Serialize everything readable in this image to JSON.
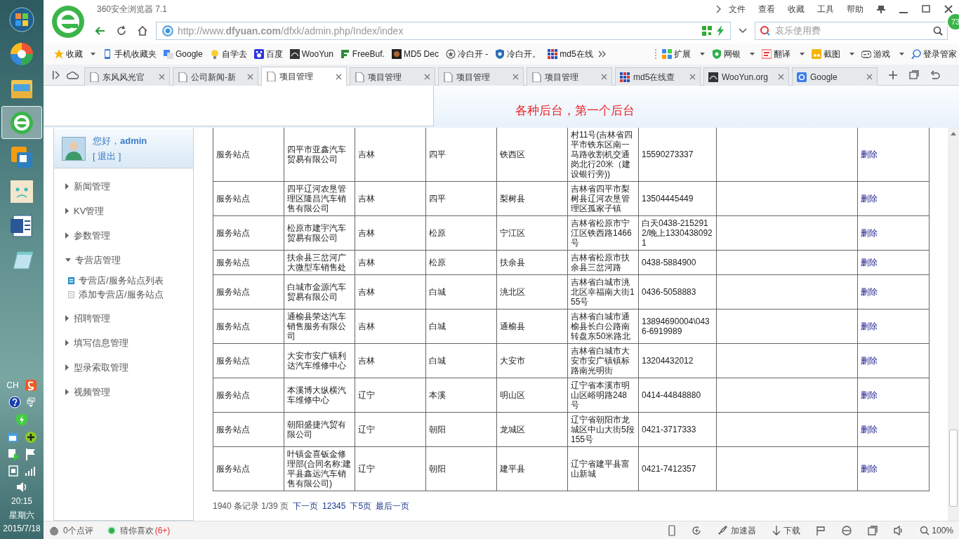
{
  "taskbar": {
    "apps": [
      {
        "kind": "start",
        "selected": false
      },
      {
        "kind": "colors",
        "selected": false
      },
      {
        "kind": "explorer",
        "selected": false
      },
      {
        "kind": "browser",
        "selected": true
      },
      {
        "kind": "vm",
        "selected": false
      },
      {
        "kind": "face",
        "selected": false
      },
      {
        "kind": "word",
        "selected": false
      },
      {
        "kind": "notepad",
        "selected": false
      }
    ],
    "language": "CH",
    "time": "20:15",
    "weekday": "星期六",
    "date": "2015/7/18"
  },
  "browser": {
    "title": "360安全浏览器 7.1",
    "menu": [
      "文件",
      "查看",
      "收藏",
      "工具",
      "帮助"
    ],
    "badge": "73",
    "address": "http://www.**dfyuan.com**/dfxk/admin.php/Index/index",
    "search_placeholder": "哀乐使用费",
    "bookmarks": [
      {
        "label": "收藏",
        "has_menu": true
      },
      {
        "label": "手机收藏夹",
        "has_menu": false
      },
      {
        "label": "Google",
        "has_menu": false
      },
      {
        "label": "自学去",
        "has_menu": false
      },
      {
        "label": "百度",
        "has_menu": false
      },
      {
        "label": "WooYun",
        "has_menu": false
      },
      {
        "label": "FreeBuf.",
        "has_menu": false
      },
      {
        "label": "MD5 Dec",
        "has_menu": false
      },
      {
        "label": "冷白开 -",
        "has_menu": false
      },
      {
        "label": "冷白开。",
        "has_menu": false
      },
      {
        "label": "md5在线",
        "has_menu": false
      }
    ],
    "tools": [
      {
        "label": "扩展",
        "has_menu": true
      },
      {
        "label": "网银",
        "has_menu": true
      },
      {
        "label": "翻译",
        "has_menu": true
      },
      {
        "label": "截图",
        "has_menu": true
      },
      {
        "label": "游戏",
        "has_menu": true
      },
      {
        "label": "登录管家",
        "has_menu": false
      }
    ],
    "tabs": [
      {
        "label": "东风风光官",
        "selected": false
      },
      {
        "label": "公司新闻-新",
        "selected": false
      },
      {
        "label": "项目管理",
        "selected": true
      },
      {
        "label": "项目管理",
        "selected": false
      },
      {
        "label": "项目管理",
        "selected": false
      },
      {
        "label": "项目管理",
        "selected": false
      },
      {
        "label": "md5在线查",
        "selected": false
      },
      {
        "label": "WooYun.org",
        "selected": false
      },
      {
        "label": "Google",
        "selected": false
      }
    ]
  },
  "page": {
    "banner": "各种后台，第一个后台",
    "user": {
      "greeting": "您好，**admin**",
      "logout": "[ 退出 ]"
    },
    "menu": [
      {
        "label": "新闻管理",
        "expanded": false
      },
      {
        "label": "KV管理",
        "expanded": false
      },
      {
        "label": "参数管理",
        "expanded": false
      },
      {
        "label": "专营店管理",
        "expanded": true,
        "children": [
          {
            "label": "专营店/服务站点列表",
            "selected": true
          },
          {
            "label": "添加专营店/服务站点",
            "selected": false
          }
        ]
      },
      {
        "label": "招聘管理",
        "expanded": false
      },
      {
        "label": "填写信息管理",
        "expanded": false
      },
      {
        "label": "型录索取管理",
        "expanded": false
      },
      {
        "label": "视频管理",
        "expanded": false
      }
    ],
    "table": {
      "rows": [
        {
          "type": "服务站点",
          "name": "四平市亚鑫汽车贸易有限公司",
          "province": "吉林",
          "city": "四平",
          "district": "铁西区",
          "address": "村11号(吉林省四平市铁东区南一马路收割机交通岗北行20米（建设银行旁))",
          "phone": "15590273337",
          "action": "删除"
        },
        {
          "type": "服务站点",
          "name": "四平辽河农垦管理区隆昌汽车销售有限公司",
          "province": "吉林",
          "city": "四平",
          "district": "梨树县",
          "address": "吉林省四平市梨树县辽河农垦管理区孤家子镇",
          "phone": "13504445449",
          "action": "删除"
        },
        {
          "type": "服务站点",
          "name": "松原市建宇汽车贸易有限公司",
          "province": "吉林",
          "city": "松原",
          "district": "宁江区",
          "address": "吉林省松原市宁江区铁西路1466号",
          "phone": "白天0438-2152912/晚上13304380921",
          "action": "删除"
        },
        {
          "type": "服务站点",
          "name": "扶余县三岔河广大微型车销售处",
          "province": "吉林",
          "city": "松原",
          "district": "扶余县",
          "address": "吉林省松原市扶余县三岔河路",
          "phone": "0438-5884900",
          "action": "删除"
        },
        {
          "type": "服务站点",
          "name": "白城市金源汽车贸易有限公司",
          "province": "吉林",
          "city": "白城",
          "district": "洮北区",
          "address": "吉林省白城市洮北区幸福南大街155号",
          "phone": "0436-5058883",
          "action": "删除"
        },
        {
          "type": "服务站点",
          "name": "通榆县荣达汽车销售服务有限公司",
          "province": "吉林",
          "city": "白城",
          "district": "通榆县",
          "address": "吉林省白城市通榆县长白公路南转盘东50米路北",
          "phone": "13894690004\\0436-6919989",
          "action": "删除"
        },
        {
          "type": "服务站点",
          "name": "大安市安广镇利达汽车维修中心",
          "province": "吉林",
          "city": "白城",
          "district": "大安市",
          "address": "吉林省白城市大安市安广镇镇标路南光明街",
          "phone": "13204432012",
          "action": "删除"
        },
        {
          "type": "服务站点",
          "name": "本溪博大纵横汽车维修中心",
          "province": "辽宁",
          "city": "本溪",
          "district": "明山区",
          "address": "辽宁省本溪市明山区峪明路248号",
          "phone": "0414-44848880",
          "action": "删除"
        },
        {
          "type": "服务站点",
          "name": "朝阳盛捷汽贸有限公司",
          "province": "辽宁",
          "city": "朝阳",
          "district": "龙城区",
          "address": "辽宁省朝阳市龙城区中山大街5段155号",
          "phone": "0421-3717333",
          "action": "删除"
        },
        {
          "type": "服务站点",
          "name": "叶镇金喜钣金修理部(合同名称:建平县鑫远汽车销售有限公司)",
          "province": "辽宁",
          "city": "朝阳",
          "district": "建平县",
          "address": "辽宁省建平县富山新城",
          "phone": "0421-7412357",
          "action": "删除"
        }
      ]
    },
    "pagination": {
      "summary": "1940 条记录 1/39 页",
      "links": [
        "下一页",
        "12345",
        "下5页",
        "最后一页"
      ]
    }
  },
  "status_bar": {
    "reviews": "0个点评",
    "recommend": "猜你喜欢",
    "recommend_count": "(6+)",
    "accelerator": "加速器",
    "download": "下载",
    "zoom": "100%"
  }
}
